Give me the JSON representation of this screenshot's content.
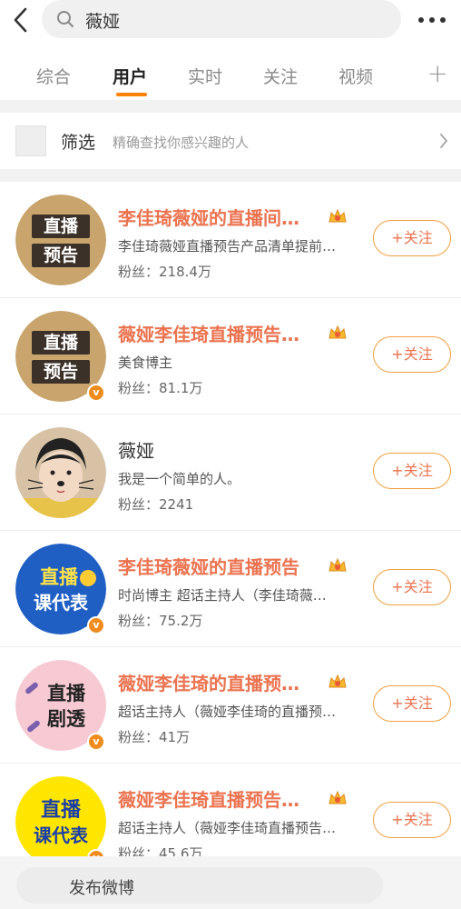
{
  "search": {
    "query": "薇娅"
  },
  "tabs": [
    {
      "label": "综合"
    },
    {
      "label": "用户"
    },
    {
      "label": "实时"
    },
    {
      "label": "关注"
    },
    {
      "label": "视频"
    }
  ],
  "filter": {
    "title": "筛选",
    "desc": "精确查找你感兴趣的人"
  },
  "follow_label": "+关注",
  "users": [
    {
      "name": "李佳琦薇娅的直播间…",
      "desc": "李佳琦薇娅直播预告产品清单提前…",
      "fans": "粉丝：218.4万",
      "avatar_text": [
        "直播",
        "预告"
      ]
    },
    {
      "name": "薇娅李佳琦直播预告…",
      "desc": "美食博主",
      "fans": "粉丝：81.1万",
      "avatar_text": [
        "直播",
        "预告"
      ]
    },
    {
      "name": "薇娅",
      "desc": "我是一个简单的人。",
      "fans": "粉丝：2241"
    },
    {
      "name": "李佳琦薇娅的直播预告",
      "desc": "时尚博主 超话主持人（李佳琦薇…",
      "fans": "粉丝：75.2万",
      "avatar_text": [
        "直播",
        "课代表"
      ]
    },
    {
      "name": "薇娅李佳琦的直播预…",
      "desc": "超话主持人（薇娅李佳琦的直播预…",
      "fans": "粉丝：41万",
      "avatar_text": [
        "直播",
        "剧透"
      ]
    },
    {
      "name": "薇娅李佳琦直播预告…",
      "desc": "超话主持人（薇娅李佳琦直播预告…",
      "fans": "粉丝：45.6万",
      "avatar_text": [
        "直播",
        "课代表"
      ]
    }
  ],
  "bottom": {
    "publish": "发布微博"
  }
}
